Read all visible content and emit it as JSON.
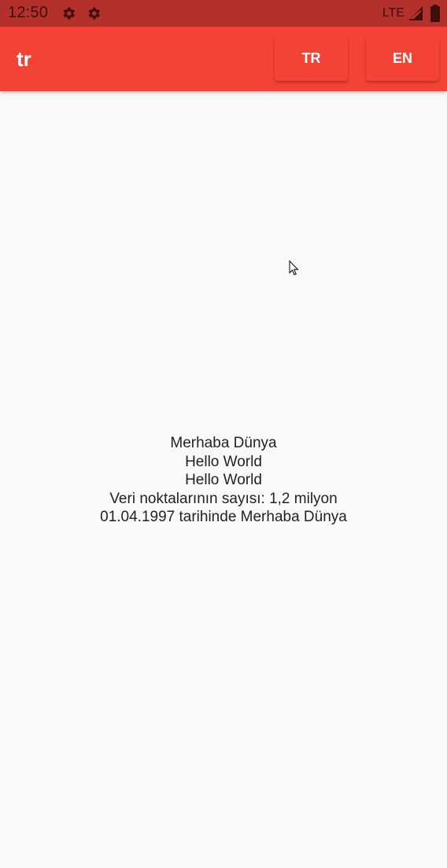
{
  "status_bar": {
    "time": "12:50",
    "icons": [
      "gear-icon",
      "gear-icon",
      "signal-icon",
      "battery-icon"
    ],
    "network": "LTE",
    "background": "#b3312a"
  },
  "app_bar": {
    "title": "tr",
    "background": "#f44336",
    "buttons": [
      {
        "label": "TR"
      },
      {
        "label": "EN"
      }
    ]
  },
  "content": {
    "lines": [
      "Merhaba Dünya",
      "Hello World",
      "Hello World",
      "Veri noktalarının sayısı: 1,2 milyon",
      "01.04.1997 tarihinde Merhaba Dünya"
    ]
  }
}
